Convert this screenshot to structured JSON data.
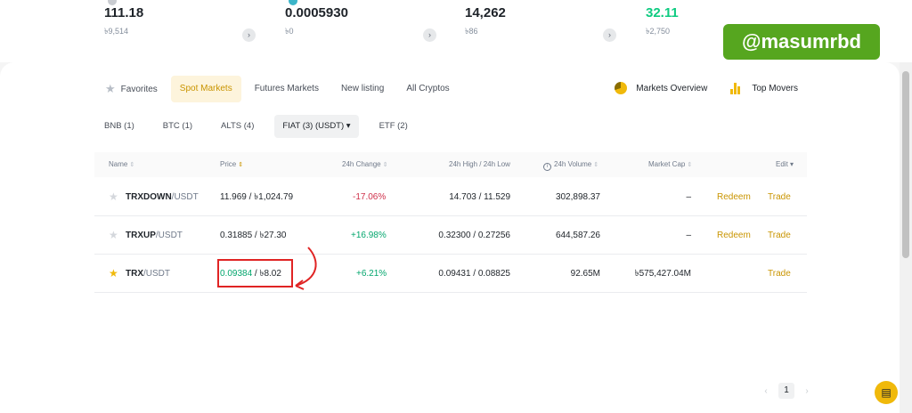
{
  "stats": [
    {
      "value": "111.18",
      "sub": "৳9,514",
      "arrow": "›"
    },
    {
      "value": "0.0005930",
      "sub": "৳0",
      "arrow": "›"
    },
    {
      "value": "14,262",
      "sub": "৳86",
      "arrow": "›"
    },
    {
      "value": "32.11",
      "sub": "৳2,750",
      "arrow": "›"
    }
  ],
  "watermark": "@masumrbd",
  "tabs": {
    "favorites": "Favorites",
    "spot": "Spot Markets",
    "futures": "Futures Markets",
    "new_listing": "New listing",
    "all_cryptos": "All Cryptos",
    "star_icon": "★"
  },
  "links": {
    "markets_overview": "Markets Overview",
    "top_movers": "Top Movers"
  },
  "subtabs": {
    "bnb": "BNB (1)",
    "btc": "BTC (1)",
    "alts": "ALTS (4)",
    "fiat": "FIAT (3) (USDT) ▾",
    "etf": "ETF (2)"
  },
  "table": {
    "headers": {
      "name": "Name",
      "price": "Price",
      "change": "24h Change",
      "high_low": "24h High / 24h Low",
      "volume": "24h Volume",
      "market_cap": "Market Cap",
      "edit": "Edit ▾",
      "sort_icon": "⇕",
      "info_icon": "i"
    },
    "rows": [
      {
        "star": "★",
        "base": "TRXDOWN",
        "quote": "/USDT",
        "price": "11.969 / ৳1,024.79",
        "change": "-17.06%",
        "high_low": "14.703 / 11.529",
        "volume": "302,898.37",
        "market_cap": "–",
        "redeem": "Redeem",
        "trade": "Trade"
      },
      {
        "star": "★",
        "base": "TRXUP",
        "quote": "/USDT",
        "price": "0.31885 / ৳27.30",
        "change": "+16.98%",
        "high_low": "0.32300 / 0.27256",
        "volume": "644,587.26",
        "market_cap": "–",
        "redeem": "Redeem",
        "trade": "Trade"
      },
      {
        "star": "★",
        "base": "TRX",
        "quote": "/USDT",
        "price_main": "0.09384",
        "price_rest": " / ৳8.02",
        "change": "+6.21%",
        "high_low": "0.09431 / 0.08825",
        "volume": "92.65M",
        "market_cap": "৳575,427.04M",
        "trade": "Trade"
      }
    ]
  },
  "pager": {
    "prev": "‹",
    "page": "1",
    "next": "›"
  },
  "chat_icon": "▤",
  "colors": {
    "accent": "#f0b90b",
    "positive": "#03a66d",
    "negative": "#cf304a",
    "annotation": "#e02424",
    "watermark_bg": "#56a61f"
  }
}
